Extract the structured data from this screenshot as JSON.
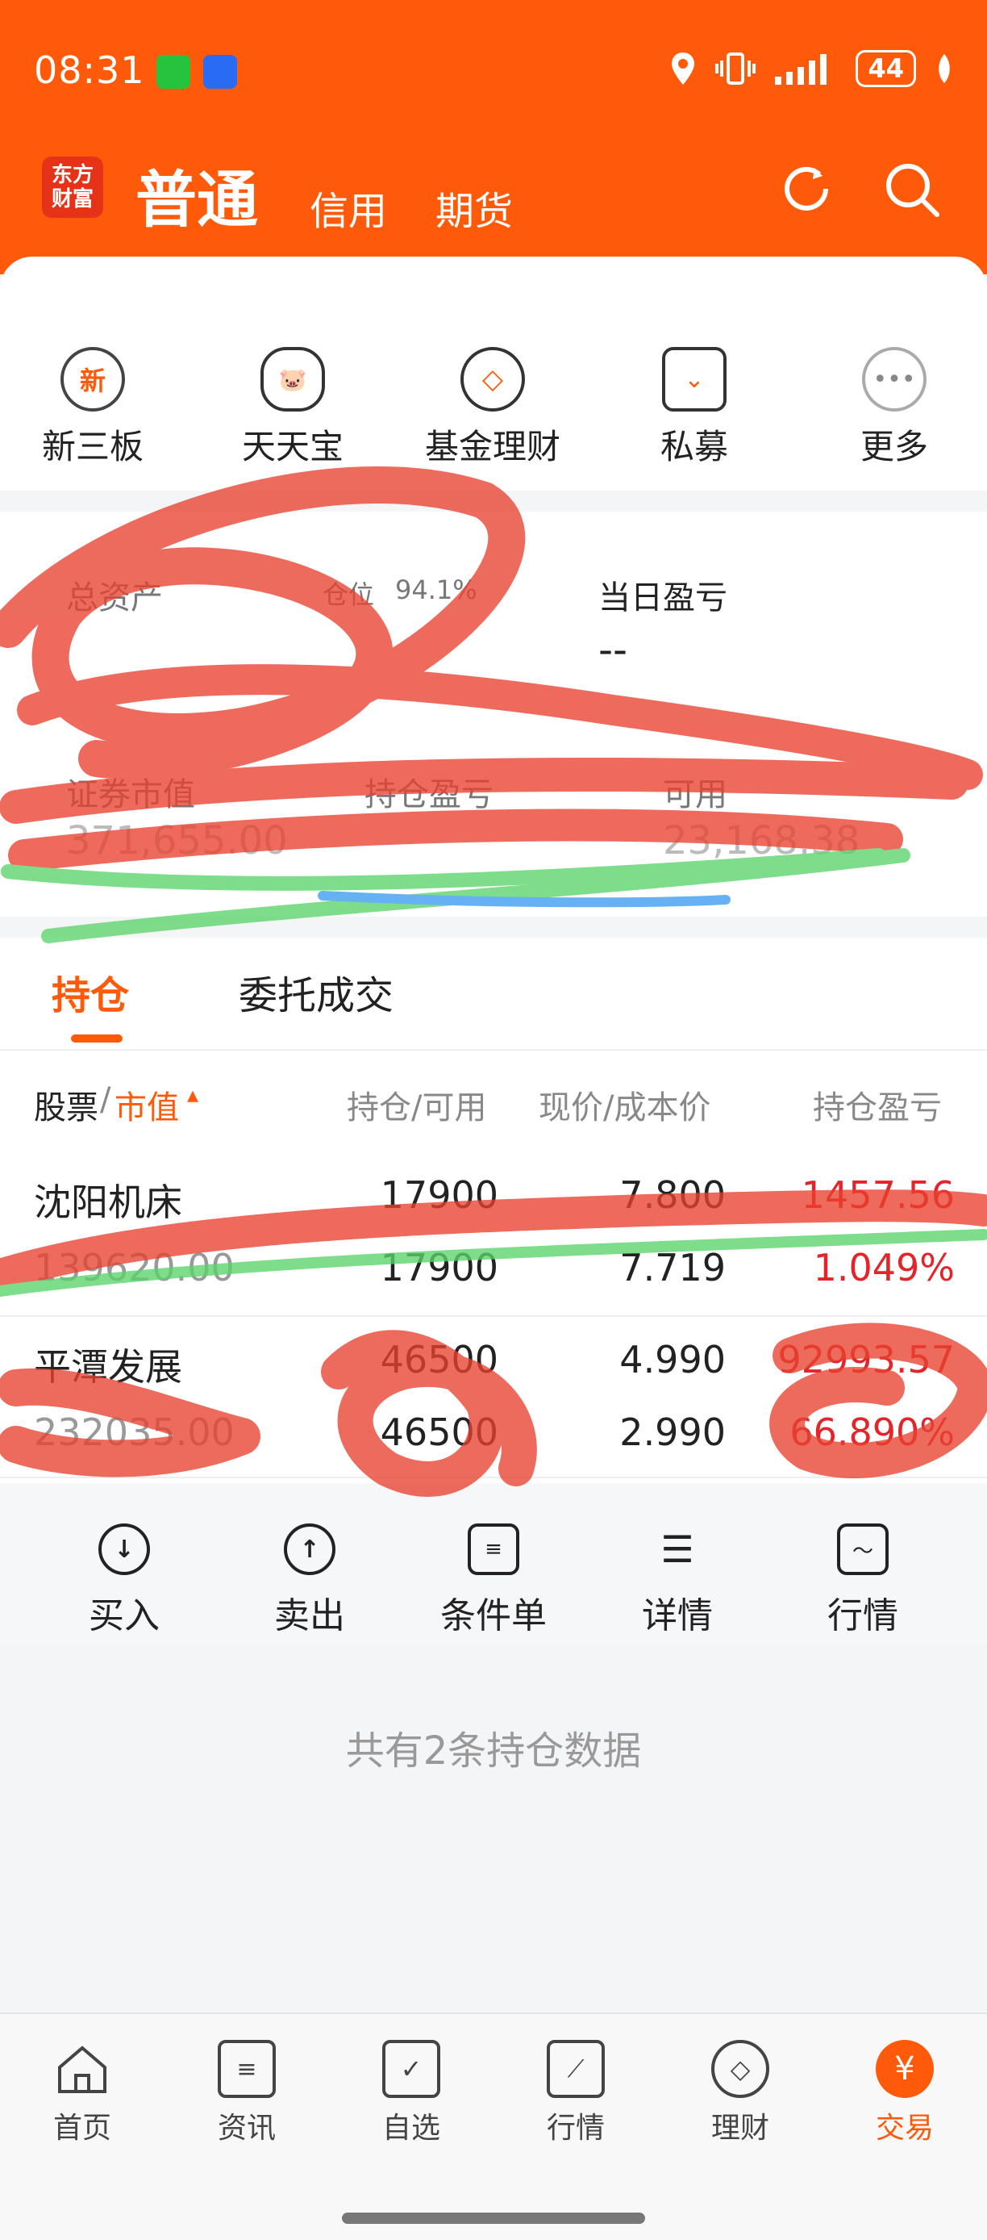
{
  "status_bar": {
    "time": "08:31",
    "battery": "44",
    "icons": [
      "wechat-icon",
      "voice-icon",
      "location-icon",
      "vibrate-icon",
      "signal-icon",
      "battery-icon"
    ]
  },
  "header": {
    "logo": "东方财富",
    "tabs": [
      "普通",
      "信用",
      "期货"
    ],
    "refresh_icon": "refresh-icon",
    "search_icon": "search-icon"
  },
  "quick_menu": [
    {
      "label": "新三板",
      "icon": "new-badge-icon"
    },
    {
      "label": "天天宝",
      "icon": "piggy-bank-icon"
    },
    {
      "label": "基金理财",
      "icon": "diamond-icon"
    },
    {
      "label": "私募",
      "icon": "gem-icon"
    },
    {
      "label": "更多",
      "icon": "more-icon"
    }
  ],
  "assets": {
    "total_label": "总资产",
    "position_label": "仓位",
    "position_value": "94.1%",
    "daily_pl_label": "当日盈亏",
    "daily_pl_value": "--",
    "market_value_label": "证券市值",
    "market_value": "371,655.00",
    "holding_pl_label": "持仓盈亏",
    "available_label": "可用",
    "available_value": "23,168.38"
  },
  "tabs": {
    "positions": "持仓",
    "orders": "委托成交"
  },
  "table": {
    "headers": {
      "stock": "股票",
      "sep": "/",
      "market_value": "市值",
      "position": "持仓/可用",
      "price": "现价/成本价",
      "pl": "持仓盈亏"
    },
    "rows": [
      {
        "name": "沈阳机床",
        "market_value": "139620.00",
        "holding": "17900",
        "available": "17900",
        "price": "7.800",
        "cost": "7.719",
        "pl": "1457.56",
        "pl_pct": "1.049%"
      },
      {
        "name": "平潭发展",
        "market_value": "232035.00",
        "holding": "46500",
        "available": "46500",
        "price": "4.990",
        "cost": "2.990",
        "pl": "92993.57",
        "pl_pct": "66.890%"
      }
    ]
  },
  "actions": [
    {
      "label": "买入",
      "icon": "buy-icon"
    },
    {
      "label": "卖出",
      "icon": "sell-icon"
    },
    {
      "label": "条件单",
      "icon": "condition-order-icon"
    },
    {
      "label": "详情",
      "icon": "details-icon"
    },
    {
      "label": "行情",
      "icon": "quote-icon"
    }
  ],
  "count_text": "共有2条持仓数据",
  "bottom_nav": [
    {
      "label": "首页",
      "icon": "home-icon"
    },
    {
      "label": "资讯",
      "icon": "news-icon"
    },
    {
      "label": "自选",
      "icon": "watchlist-icon"
    },
    {
      "label": "行情",
      "icon": "market-icon"
    },
    {
      "label": "理财",
      "icon": "wealth-icon"
    },
    {
      "label": "交易",
      "icon": "trade-icon"
    }
  ],
  "colors": {
    "accent": "#ff5a0a",
    "loss_red": "#e5242a"
  }
}
